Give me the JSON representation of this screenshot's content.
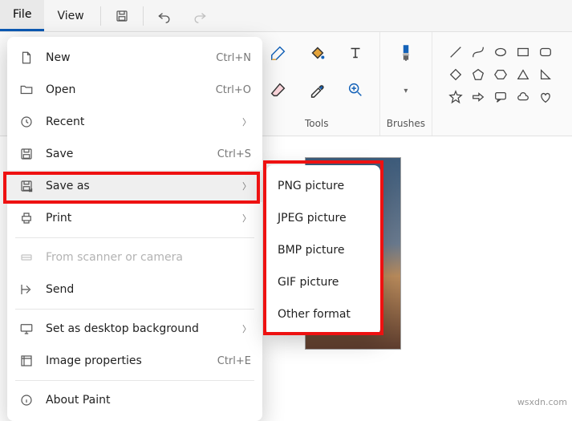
{
  "topbar": {
    "file": "File",
    "view": "View"
  },
  "ribbon": {
    "tools_label": "Tools",
    "brushes_label": "Brushes"
  },
  "menu": {
    "new": {
      "label": "New",
      "shortcut": "Ctrl+N"
    },
    "open": {
      "label": "Open",
      "shortcut": "Ctrl+O"
    },
    "recent": {
      "label": "Recent"
    },
    "save": {
      "label": "Save",
      "shortcut": "Ctrl+S"
    },
    "save_as": {
      "label": "Save as"
    },
    "print": {
      "label": "Print"
    },
    "scanner": {
      "label": "From scanner or camera"
    },
    "send": {
      "label": "Send"
    },
    "desktop": {
      "label": "Set as desktop background"
    },
    "props": {
      "label": "Image properties",
      "shortcut": "Ctrl+E"
    },
    "about": {
      "label": "About Paint"
    }
  },
  "submenu": {
    "png": "PNG picture",
    "jpeg": "JPEG picture",
    "bmp": "BMP picture",
    "gif": "GIF picture",
    "other": "Other format"
  },
  "watermark": "wsxdn.com"
}
